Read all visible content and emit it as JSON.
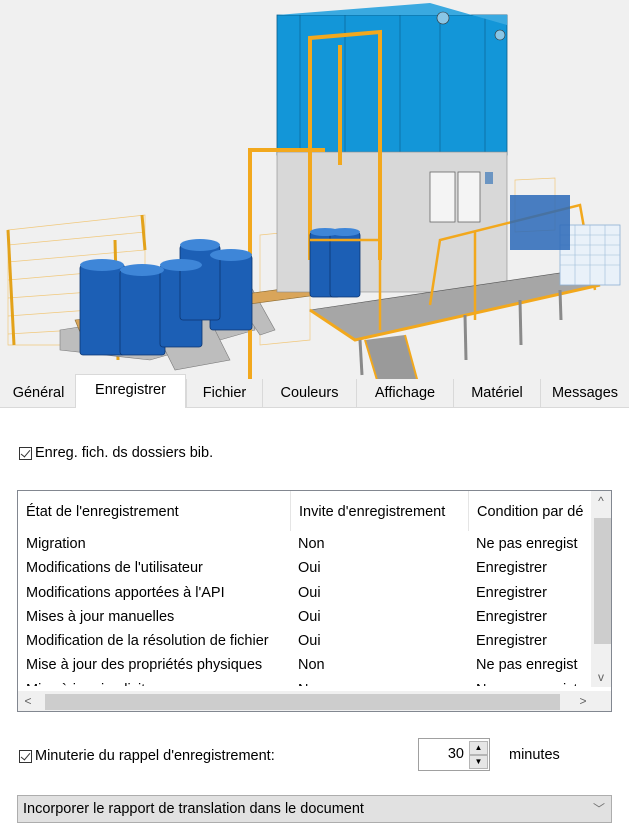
{
  "preview": {
    "description": "3D model of industrial drum filling machine with blue cabin, orange railings and blue barrels",
    "colors": {
      "cabin": "#1396d8",
      "railing": "#f2a81d",
      "barrel": "#1c5fb5",
      "frame": "#c9c9c9"
    }
  },
  "tabs": [
    {
      "label": "Général",
      "active": false
    },
    {
      "label": "Enregistrer",
      "active": true
    },
    {
      "label": "Fichier",
      "active": false
    },
    {
      "label": "Couleurs",
      "active": false
    },
    {
      "label": "Affichage",
      "active": false
    },
    {
      "label": "Matériel",
      "active": false
    },
    {
      "label": "Messages",
      "active": false
    }
  ],
  "save_in_library_folders": {
    "label": "Enreg. fich. ds dossiers bib.",
    "checked": true
  },
  "save_table": {
    "columns": [
      "État de l'enregistrement",
      "Invite d'enregistrement",
      "Condition par dé"
    ],
    "rows": [
      [
        "Migration",
        "Non",
        "Ne pas enregist"
      ],
      [
        "Modifications de l'utilisateur",
        "Oui",
        "Enregistrer"
      ],
      [
        "Modifications apportées à l'API",
        "Oui",
        "Enregistrer"
      ],
      [
        "Mises à jour manuelles",
        "Oui",
        "Enregistrer"
      ],
      [
        "Modification de la résolution de fichier",
        "Oui",
        "Enregistrer"
      ],
      [
        "Mise à jour des propriétés physiques",
        "Non",
        "Ne pas enregist"
      ],
      [
        "Mise à jour implicite",
        "Non",
        "Ne pas enregist"
      ]
    ],
    "scroll_up": "^",
    "scroll_down": "v",
    "scroll_left": "<",
    "scroll_right": ">"
  },
  "reminder_timer": {
    "label": "Minuterie du rappel d'enregistrement:",
    "checked": true,
    "value": "30",
    "unit": "minutes"
  },
  "translation_report": {
    "selected": "Incorporer le rapport de translation dans le document"
  }
}
